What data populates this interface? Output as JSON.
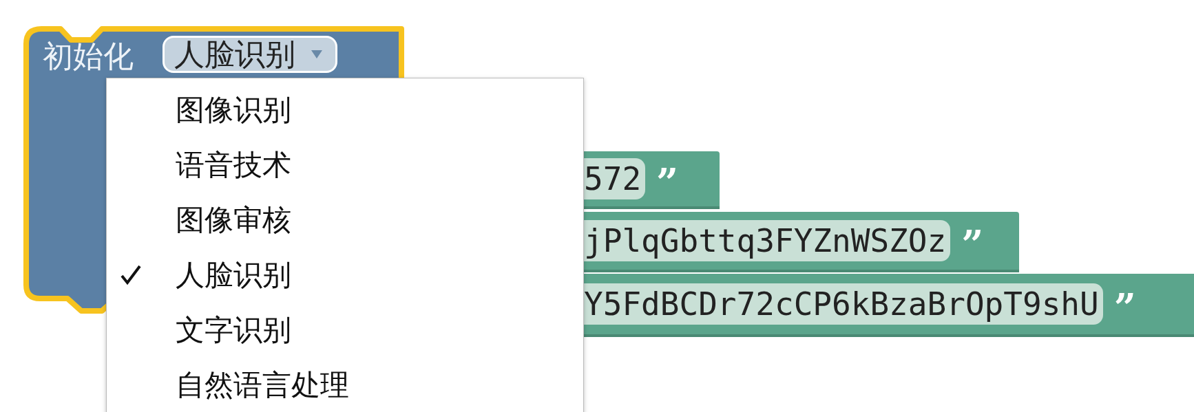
{
  "block": {
    "label": "初始化",
    "selected": true,
    "dropdown": {
      "value": "人脸识别"
    }
  },
  "menu": {
    "items": [
      {
        "label": "图像识别",
        "selected": false
      },
      {
        "label": "语音技术",
        "selected": false
      },
      {
        "label": "图像审核",
        "selected": false
      },
      {
        "label": "人脸识别",
        "selected": true
      },
      {
        "label": "文字识别",
        "selected": false
      },
      {
        "label": "自然语言处理",
        "selected": false
      }
    ]
  },
  "text_blocks": [
    {
      "value": "572",
      "quote": "”"
    },
    {
      "value": "jPlqGbttq3FYZnWSZOz",
      "quote": "”"
    },
    {
      "value": "Y5FdBCDr72cCP6kBzaBrOpT9shU",
      "quote": "”"
    }
  ]
}
